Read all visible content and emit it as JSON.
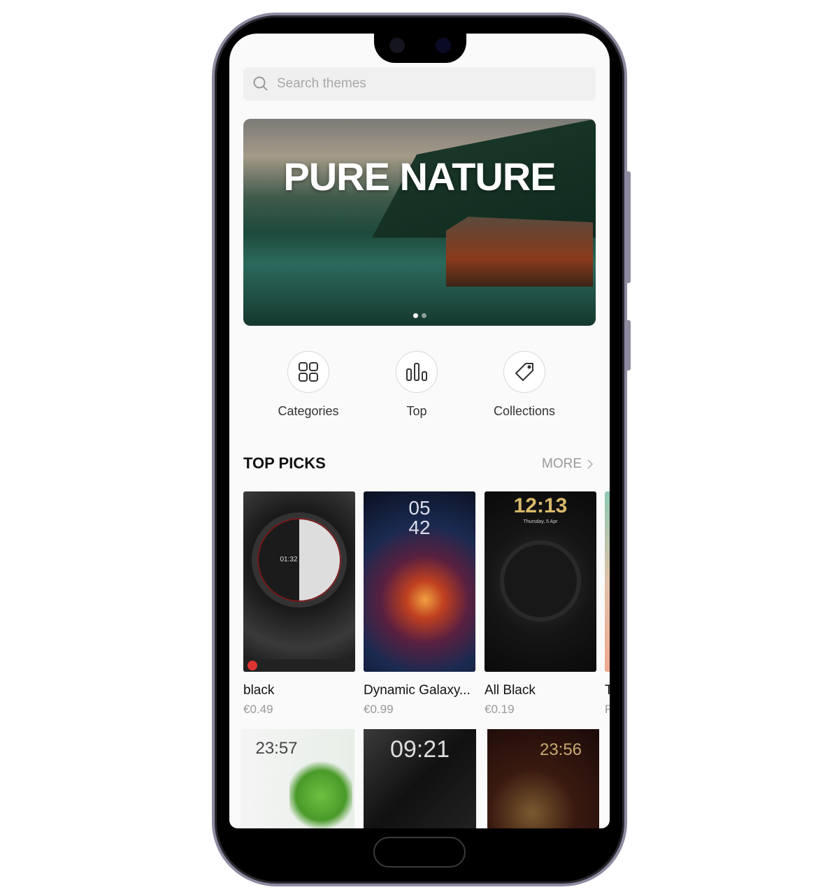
{
  "search": {
    "placeholder": "Search themes",
    "icon": "search-icon"
  },
  "banner": {
    "title": "PURE NATURE",
    "slides": 2,
    "active_slide": 0
  },
  "quick_actions": [
    {
      "label": "Categories",
      "icon": "grid-icon"
    },
    {
      "label": "Top",
      "icon": "bar-chart-icon"
    },
    {
      "label": "Collections",
      "icon": "tag-icon"
    }
  ],
  "top_picks": {
    "title": "TOP PICKS",
    "more_label": "MORE",
    "items": [
      {
        "name": "black",
        "price": "€0.49",
        "clock": "01:32"
      },
      {
        "name": "Dynamic Galaxy...",
        "price": "€0.99",
        "clock": "05\n42"
      },
      {
        "name": "All Black",
        "price": "€0.19",
        "clock": "12:13",
        "date": "Thursday, 5 Apr"
      },
      {
        "name": "T",
        "price": "F"
      }
    ],
    "row2": [
      {
        "clock": "23:57"
      },
      {
        "clock": "09:21"
      },
      {
        "clock": "23:56"
      }
    ]
  },
  "colors": {
    "frame": "#8e8aa0",
    "search_bg": "#f0f0f0",
    "muted_text": "#999999"
  }
}
